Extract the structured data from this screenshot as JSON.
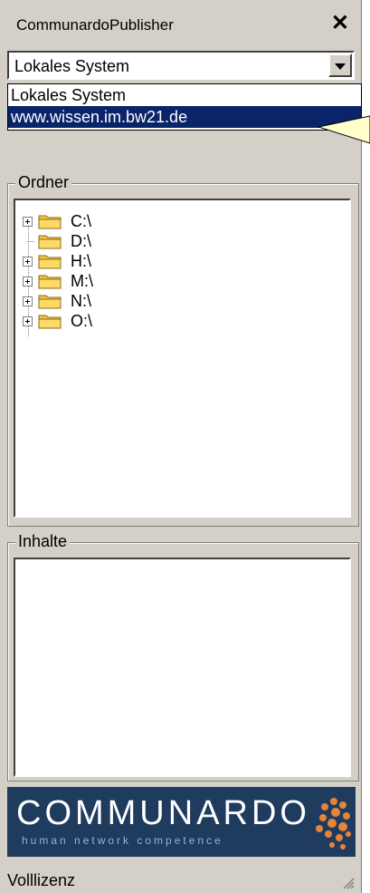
{
  "window": {
    "title": "CommunardoPublisher",
    "close_symbol": "✕"
  },
  "source_select": {
    "value": "Lokales System"
  },
  "dropdown": {
    "options": [
      "Lokales System",
      "www.wissen.im.bw21.de"
    ],
    "selected": "www.wissen.im.bw21.de"
  },
  "folders": {
    "label": "Ordner",
    "items": [
      {
        "name": "C:\\",
        "expandable": true
      },
      {
        "name": "D:\\",
        "expandable": false
      },
      {
        "name": "H:\\",
        "expandable": true
      },
      {
        "name": "M:\\",
        "expandable": true
      },
      {
        "name": "N:\\",
        "expandable": true
      },
      {
        "name": "O:\\",
        "expandable": true
      }
    ]
  },
  "contents": {
    "label": "Inhalte"
  },
  "logo": {
    "wordmark": "COMMUNARDO",
    "tagline": "human network competence"
  },
  "status": {
    "text": "Volllizenz"
  },
  "colors": {
    "selection": "#0a246a",
    "logo_bg": "#1f3b5d",
    "callout": "#ffffcc",
    "folder": "#f5c542"
  }
}
